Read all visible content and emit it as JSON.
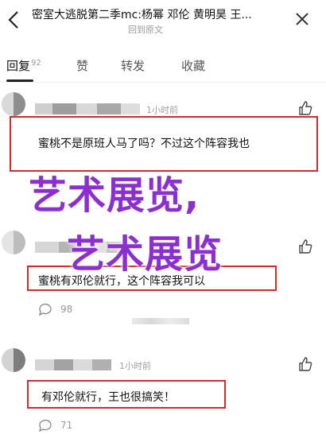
{
  "header": {
    "title": "密室大逃脱第二季mc:杨幂 邓伦 黄明昊 王...",
    "subtitle": "回到原文"
  },
  "tabs": [
    {
      "label": "回复",
      "count": "92",
      "active": true
    },
    {
      "label": "赞",
      "active": false
    },
    {
      "label": "转发",
      "active": false
    },
    {
      "label": "收藏",
      "active": false
    }
  ],
  "comments": [
    {
      "timestamp": "1小时前",
      "text": "蜜桃不是原班人马了吗？不过这个阵容我也"
    },
    {
      "timestamp": "1小时前",
      "text": "蜜桃有邓伦就行，这个阵容我可以",
      "reply_count": "98"
    },
    {
      "timestamp": "1小时前",
      "text": "有邓伦就行，王也很搞笑！",
      "reply_count": "71"
    }
  ],
  "overlay": {
    "watermark_line1": "艺术展览,",
    "watermark_line2": "艺术展览",
    "watermark_color": "#8c2fd1",
    "highlight_color": "#d42a2a"
  },
  "icons": [
    "back-icon",
    "close-icon",
    "like-icon",
    "reply-icon"
  ]
}
